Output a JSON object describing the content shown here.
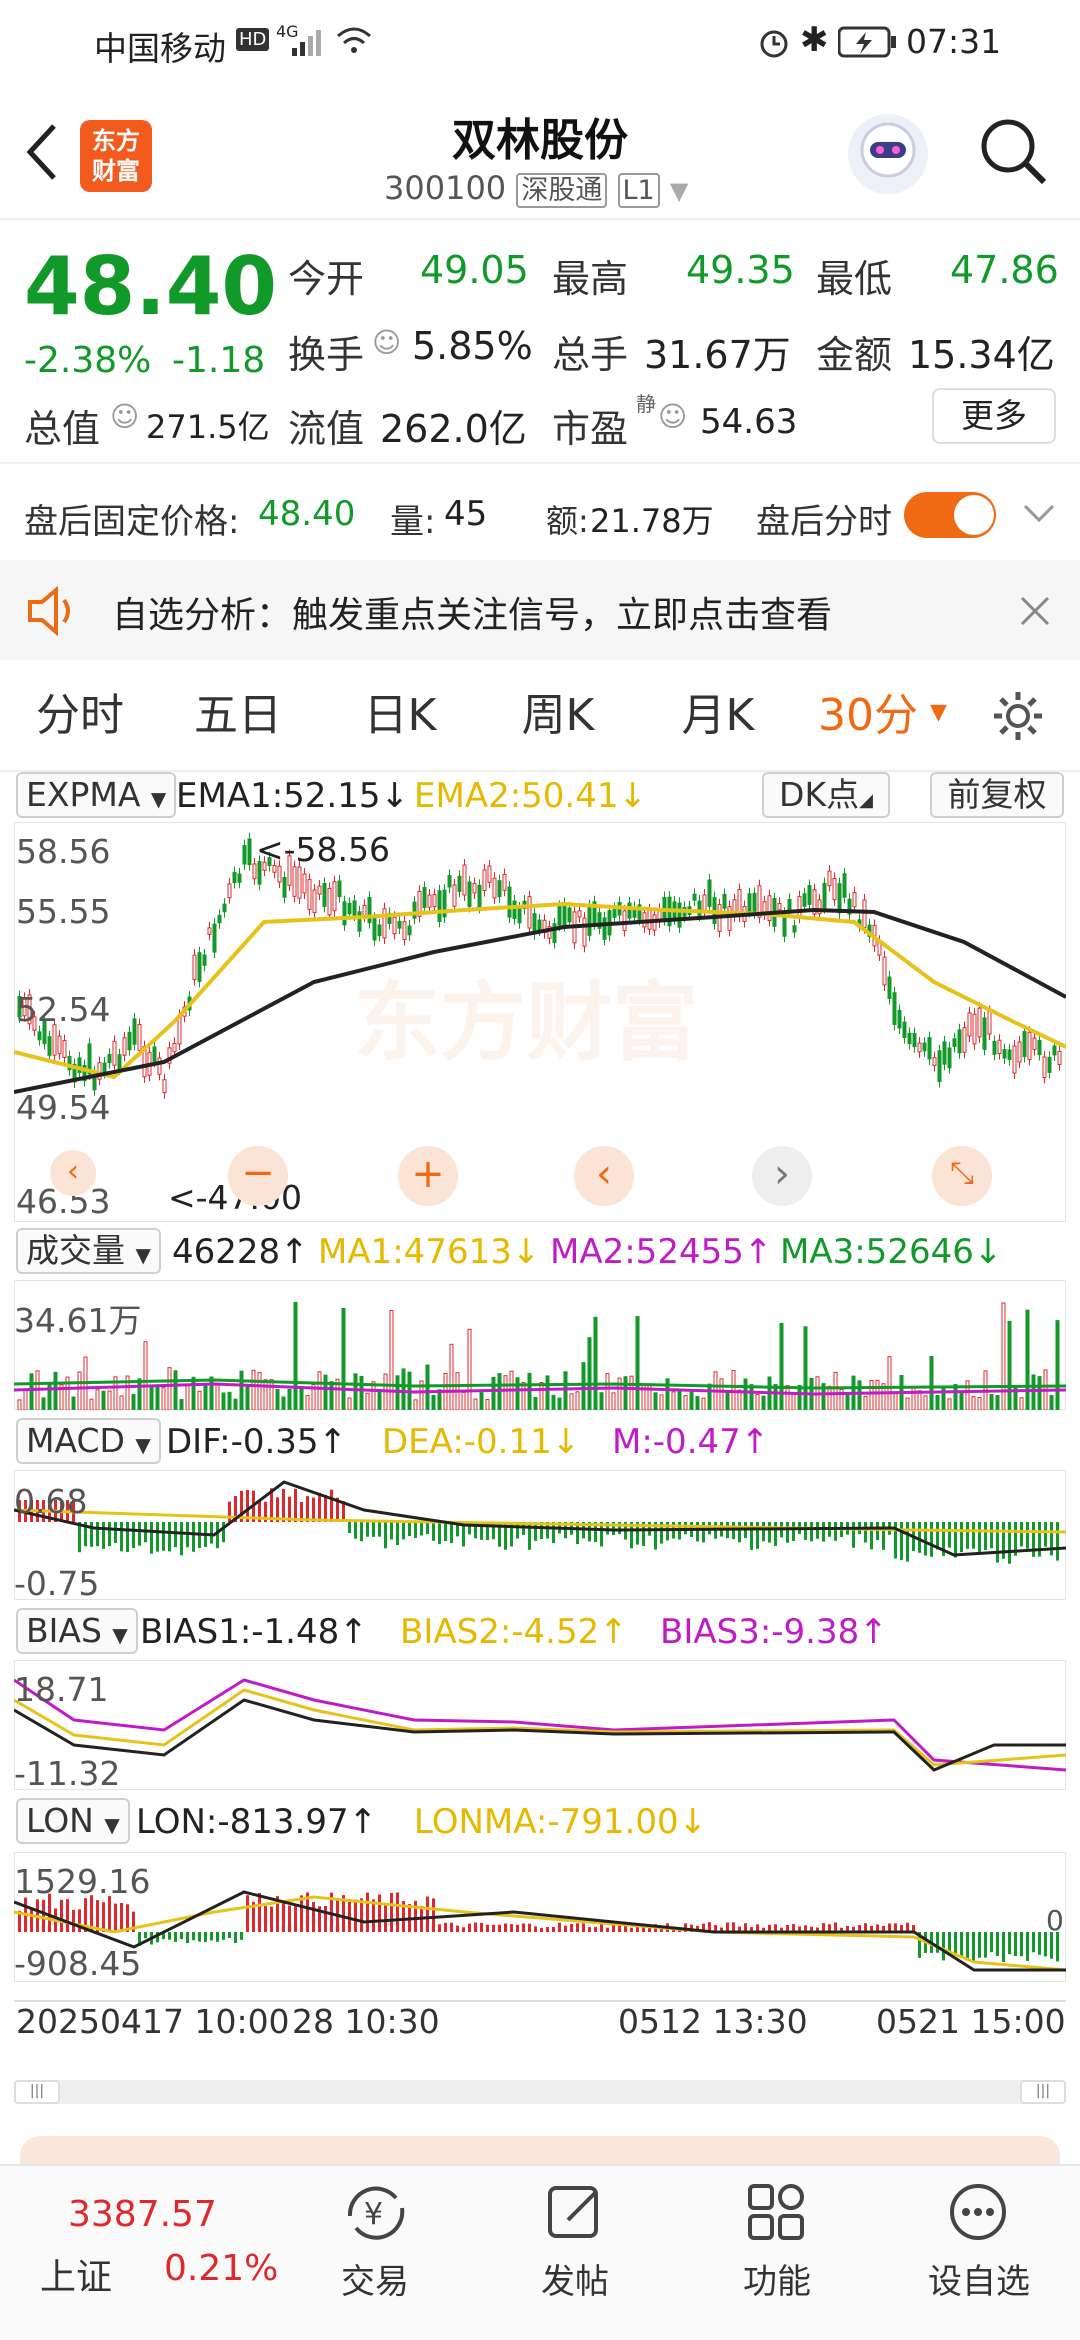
{
  "status_bar": {
    "carrier": "中国移动",
    "hd": "HD",
    "network": "4G",
    "time": "07:31"
  },
  "header": {
    "title": "双林股份",
    "code": "300100",
    "exchange_tag": "深股通",
    "level": "L1",
    "logo_line1": "东方",
    "logo_line2": "财富"
  },
  "quote": {
    "price": "48.40",
    "change_pct": "-2.38%",
    "change": "-1.18",
    "open_label": "今开",
    "open": "49.05",
    "high_label": "最高",
    "high": "49.35",
    "low_label": "最低",
    "low": "47.86",
    "turnover_label": "换手",
    "turnover": "5.85%",
    "volume_label": "总手",
    "volume": "31.67万",
    "amount_label": "金额",
    "amount": "15.34亿",
    "mktcap_label": "总值",
    "mktcap": "271.5亿",
    "float_label": "流值",
    "float_cap": "262.0亿",
    "pe_label": "市盈",
    "pe_sup": "静",
    "pe": "54.63",
    "more_button": "更多"
  },
  "after_hours": {
    "price_label": "盘后固定价格:",
    "price": "48.40",
    "volume_label": "量:",
    "volume": "45",
    "amount_label": "额:",
    "amount": "21.78万",
    "toggle_label": "盘后分时",
    "toggle_on": true
  },
  "notice": {
    "text": "自选分析：触发重点关注信号，立即点击查看"
  },
  "period_tabs": [
    {
      "label": "分时"
    },
    {
      "label": "五日"
    },
    {
      "label": "日K"
    },
    {
      "label": "周K"
    },
    {
      "label": "月K"
    },
    {
      "label": "30分",
      "active": true
    }
  ],
  "main_chart": {
    "indicator": "EXPMA",
    "ema1": "EMA1:52.15↓",
    "ema2": "EMA2:50.41↓",
    "dk_button": "DK点",
    "adjust_button": "前复权",
    "y_labels": [
      "58.56",
      "55.55",
      "52.54",
      "49.54",
      "46.53"
    ],
    "max_marker": "<-58.56",
    "min_marker": "<-47.00",
    "watermark": "东方财富"
  },
  "volume_panel": {
    "indicator": "成交量",
    "value": "46228↑",
    "ma1": "MA1:47613↓",
    "ma2": "MA2:52455↑",
    "ma3": "MA3:52646↓",
    "y_label": "34.61万"
  },
  "macd_panel": {
    "indicator": "MACD",
    "dif": "DIF:-0.35↑",
    "dea": "DEA:-0.11↓",
    "m": "M:-0.47↑",
    "y_top": "0.68",
    "y_bottom": "-0.75"
  },
  "bias_panel": {
    "indicator": "BIAS",
    "b1": "BIAS1:-1.48↑",
    "b2": "BIAS2:-4.52↑",
    "b3": "BIAS3:-9.38↑",
    "y_top": "18.71",
    "y_bottom": "-11.32"
  },
  "lon_panel": {
    "indicator": "LON",
    "lon": "LON:-813.97↑",
    "lonma": "LONMA:-791.00↓",
    "y_top": "1529.16",
    "y_bottom": "-908.45",
    "zero": "0"
  },
  "x_axis": {
    "labels": [
      "20250417 10:00",
      "28 10:30",
      "0512 13:30",
      "0521 15:00"
    ]
  },
  "bottom_nav": {
    "index_value": "3387.57",
    "index_name": "上证",
    "index_change": "0.21%",
    "items": [
      {
        "label": "交易"
      },
      {
        "label": "发帖"
      },
      {
        "label": "功能"
      },
      {
        "label": "设自选"
      }
    ]
  },
  "colors": {
    "up": "#e0282c",
    "down": "#119a2a",
    "accent": "#f06a14",
    "ema1": "#222222",
    "ema2": "#e6c21a"
  }
}
